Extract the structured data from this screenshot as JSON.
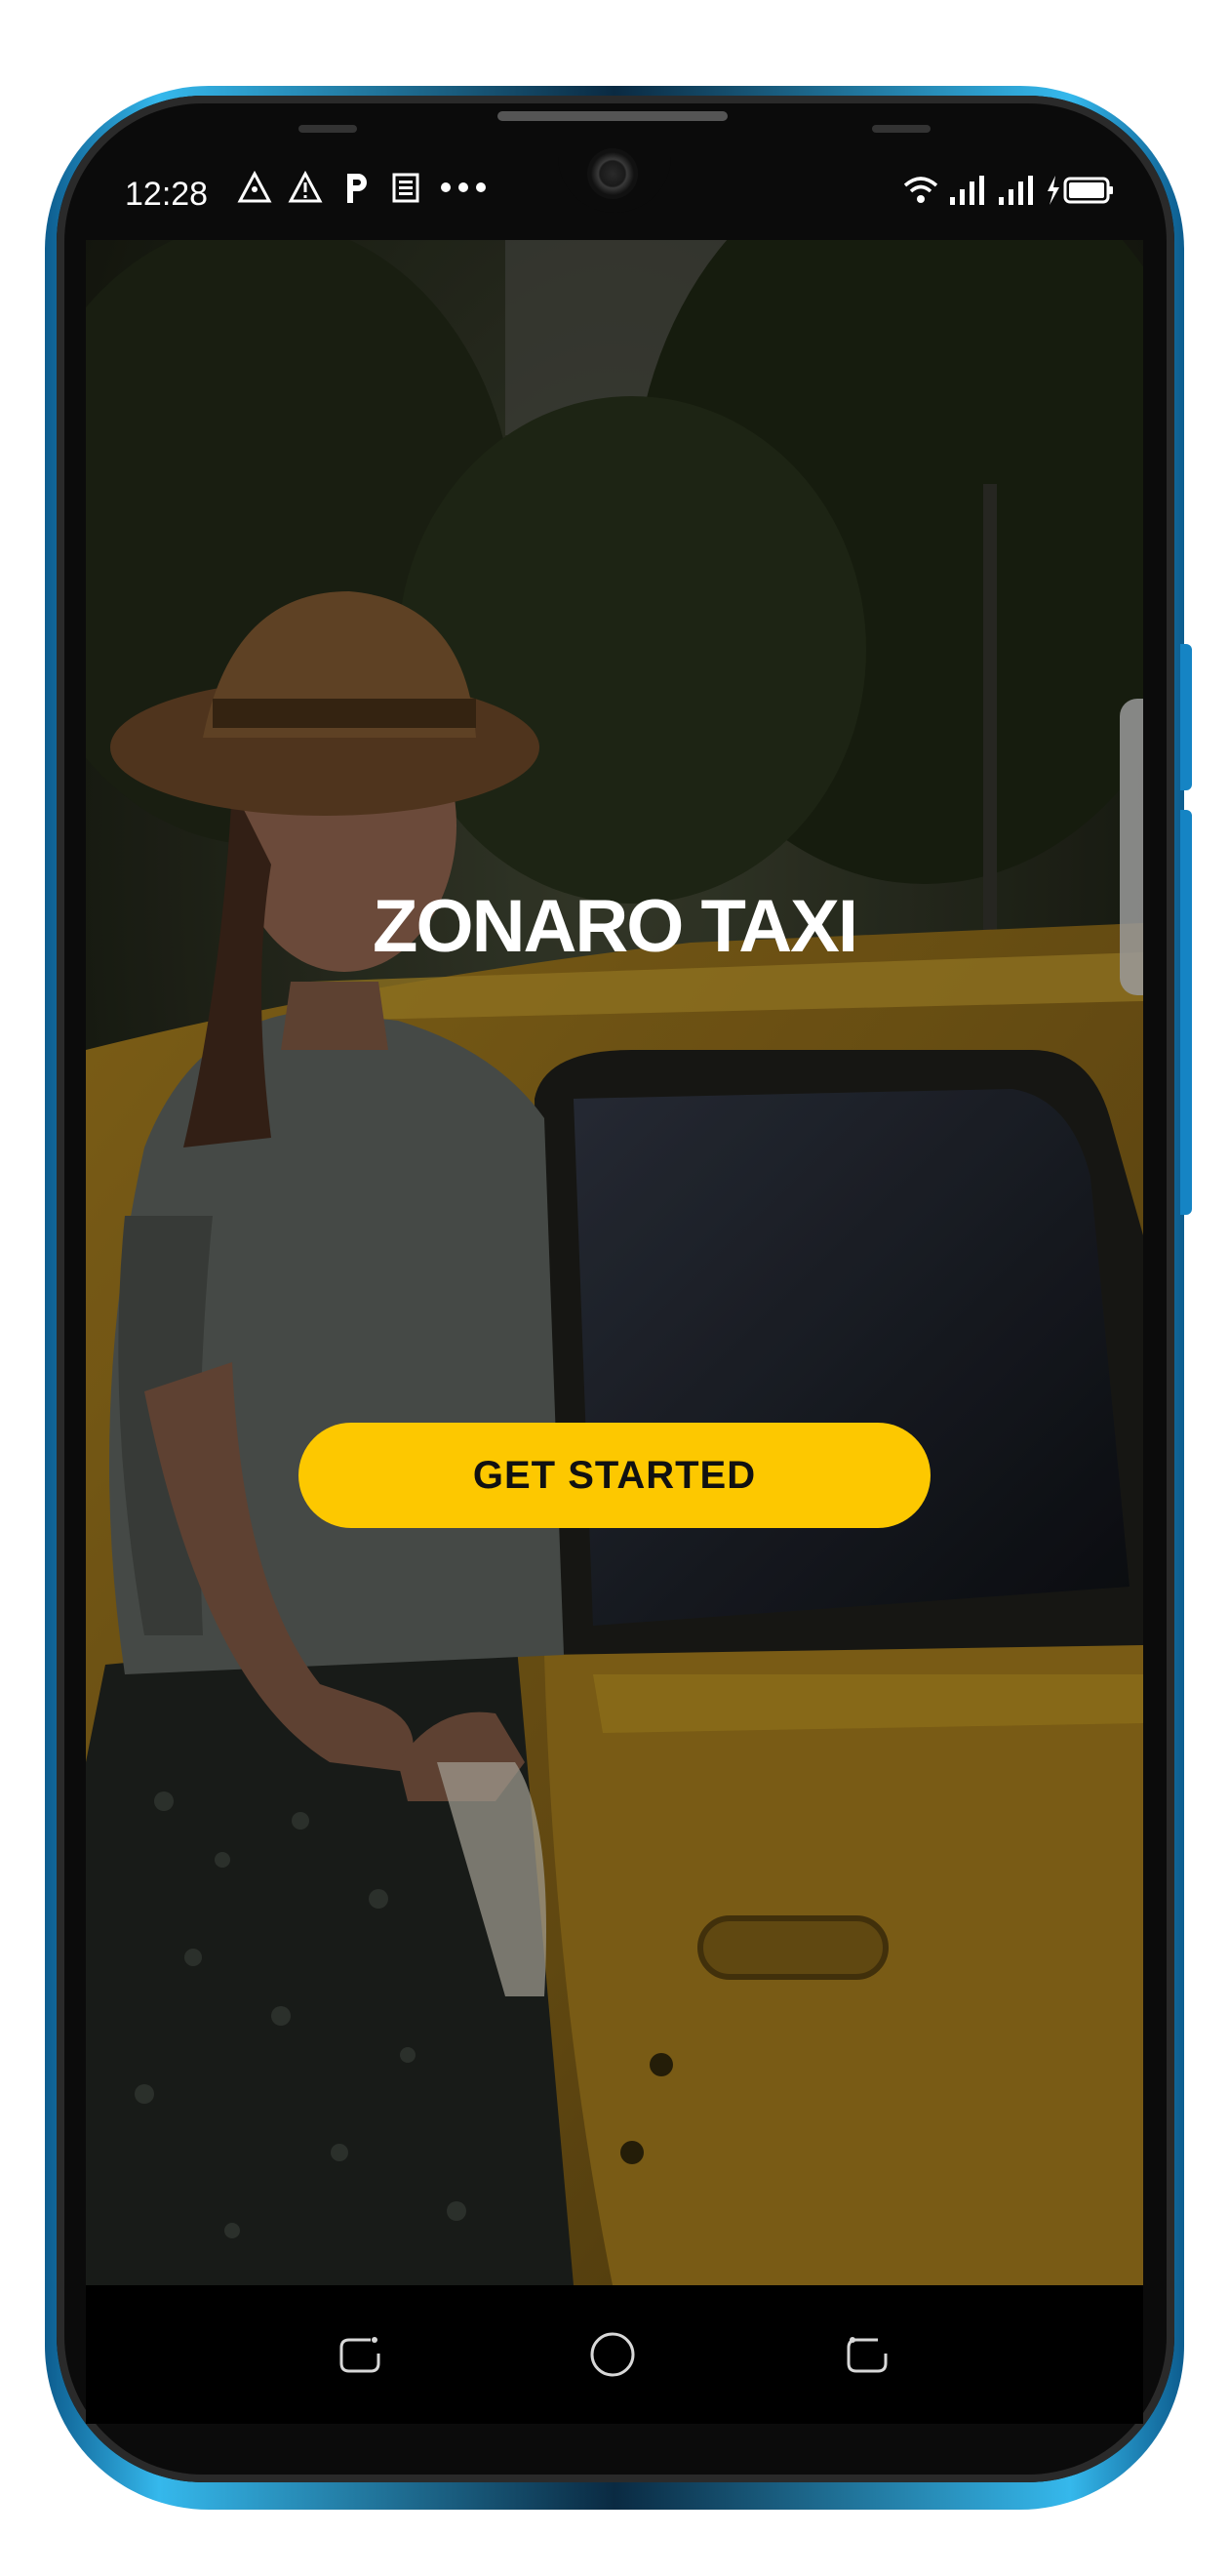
{
  "status_bar": {
    "time": "12:28",
    "left_icons": [
      "triangle-warning-outline-icon",
      "warning-icon",
      "parking-icon",
      "news-icon",
      "more-dots-icon"
    ],
    "right_icons": [
      "wifi-icon",
      "signal-icon",
      "signal-icon",
      "charging-battery-icon"
    ]
  },
  "splash": {
    "title": "ZONARO TAXI",
    "cta_label": "GET STARTED"
  },
  "theme": {
    "accent": "#fdc800",
    "text_on_accent": "#111111",
    "text": "#ffffff"
  },
  "nav_bar": {
    "icons": [
      "recent-apps-icon",
      "home-icon",
      "back-icon"
    ]
  }
}
